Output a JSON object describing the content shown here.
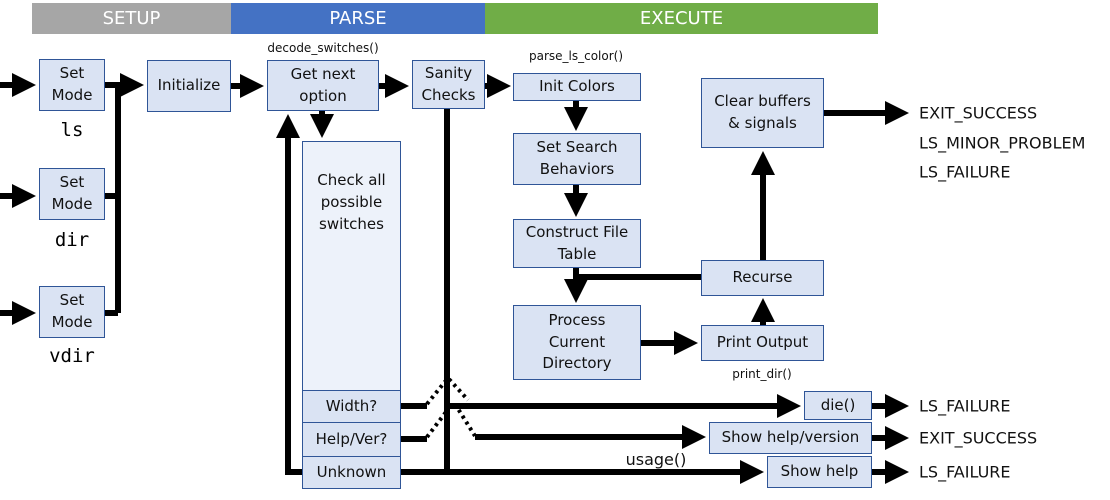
{
  "phases": [
    {
      "label": "SETUP",
      "color": "#a6a6a6"
    },
    {
      "label": "PARSE",
      "color": "#4472c4"
    },
    {
      "label": "EXECUTE",
      "color": "#70ad47"
    }
  ],
  "setup": {
    "set_mode": "Set Mode",
    "modes": [
      "ls",
      "dir",
      "vdir"
    ],
    "initialize": "Initialize"
  },
  "parse": {
    "function": "decode_switches()",
    "get_next": "Get next option",
    "check_all": "Check all possible switches",
    "width": "Width?",
    "help_ver": "Help/Ver?",
    "unknown": "Unknown",
    "sanity": "Sanity Checks"
  },
  "execute": {
    "function": "parse_ls_color()",
    "init_colors": "Init Colors",
    "search": "Set Search Behaviors",
    "construct": "Construct File Table",
    "process": "Process Current Directory",
    "print": "Print Output",
    "print_fn": "print_dir()",
    "recurse": "Recurse",
    "clear": "Clear buffers & signals"
  },
  "errors": {
    "die": "die()",
    "show_help_version": "Show help/version",
    "show_help": "Show help",
    "usage": "usage()"
  },
  "outputs": {
    "top": [
      "EXIT_SUCCESS",
      "LS_MINOR_PROBLEM",
      "LS_FAILURE"
    ],
    "die": "LS_FAILURE",
    "help_version": "EXIT_SUCCESS",
    "help": "LS_FAILURE"
  },
  "colors": {
    "box_fill": "#dae3f3",
    "box_border": "#2f5597"
  }
}
